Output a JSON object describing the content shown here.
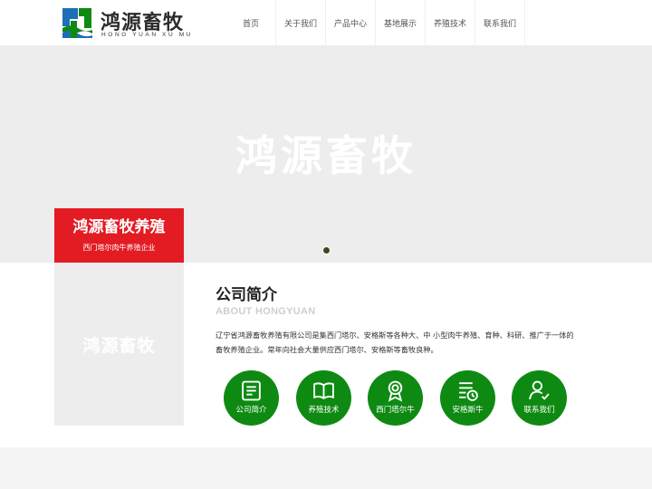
{
  "brand": {
    "title": "鸿源畜牧",
    "subtitle": "HONG YUAN XU MU",
    "colors": {
      "green": "#0e8a12",
      "blue": "#1c6fb8",
      "red": "#e31b23"
    }
  },
  "nav": {
    "items": [
      {
        "label": "首页"
      },
      {
        "label": "关于我们"
      },
      {
        "label": "产品中心"
      },
      {
        "label": "基地展示"
      },
      {
        "label": "养殖技术"
      },
      {
        "label": "联系我们"
      }
    ]
  },
  "banner": {
    "text": "鸿源畜牧"
  },
  "redbox": {
    "title": "鸿源畜牧养殖",
    "subtitle": "西门塔尔肉牛养殖企业"
  },
  "about": {
    "image_text": "鸿源畜牧",
    "title": "公司简介",
    "title_en": "ABOUT HONGYUAN",
    "description": "辽宁省鸿源畜牧养殖有限公司是集西门塔尔、安格斯等各种大、中 小型肉牛养殖、育种、科研、推广于一体的畜牧养殖企业。常年向社会大量供应西门塔尔、安格斯等畜牧良种。"
  },
  "icons": [
    {
      "label": "公司简介",
      "icon": "document-icon"
    },
    {
      "label": "养殖技术",
      "icon": "book-icon"
    },
    {
      "label": "西门塔尔牛",
      "icon": "award-icon"
    },
    {
      "label": "安格斯牛",
      "icon": "list-clock-icon"
    },
    {
      "label": "联系我们",
      "icon": "contact-user-icon"
    }
  ]
}
